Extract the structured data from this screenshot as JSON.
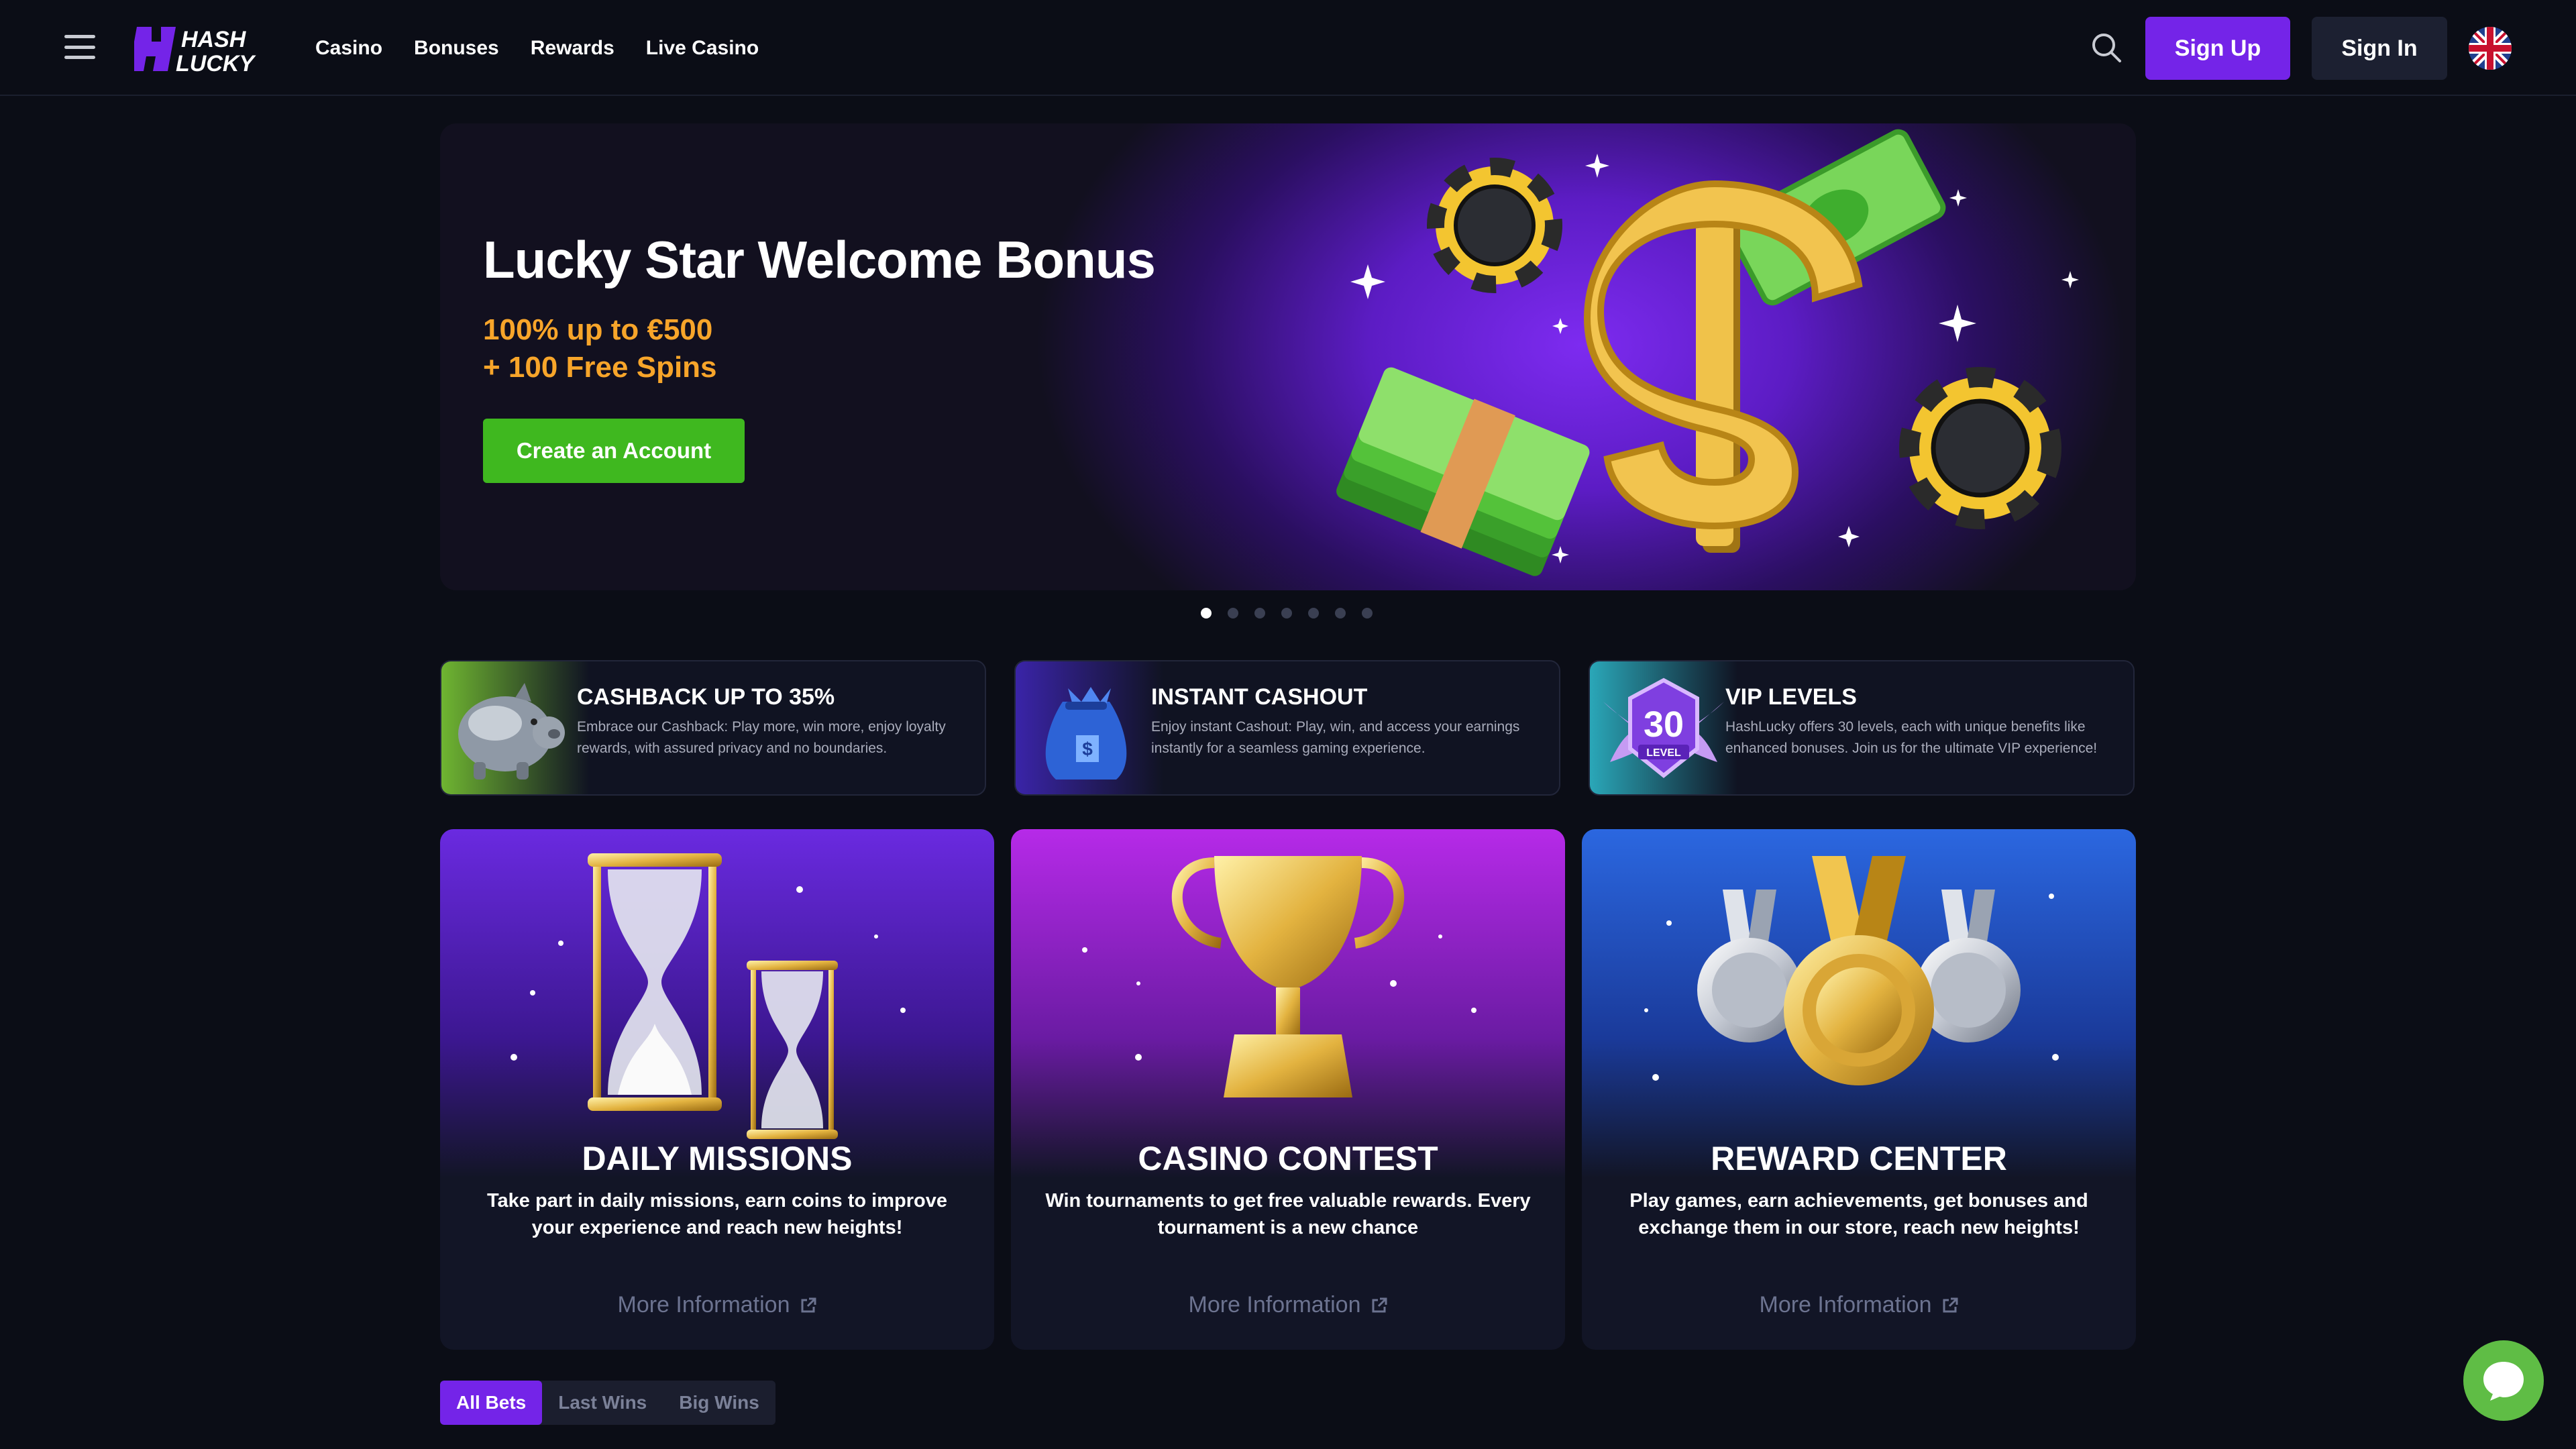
{
  "header": {
    "logo_line1": "HASH",
    "logo_line2": "LUCKY",
    "nav": [
      "Casino",
      "Bonuses",
      "Rewards",
      "Live Casino"
    ],
    "signup_label": "Sign Up",
    "signin_label": "Sign In",
    "language_icon": "uk-flag-icon"
  },
  "hero": {
    "title": "Lucky Star Welcome Bonus",
    "subtitle_line1": "100% up to €500",
    "subtitle_line2": "+ 100 Free Spins",
    "cta_label": "Create an Account",
    "carousel_total": 7,
    "carousel_active": 1
  },
  "promos": [
    {
      "title": "CASHBACK UP TO 35%",
      "description": "Embrace our Cashback: Play more, win more, enjoy loyalty rewards, with assured privacy and no boundaries.",
      "icon": "piggy-bank-icon"
    },
    {
      "title": "INSTANT CASHOUT",
      "description": "Enjoy instant Cashout: Play, win, and access your earnings instantly for a seamless gaming experience.",
      "icon": "money-bag-icon"
    },
    {
      "title": "VIP LEVELS",
      "description": "HashLucky offers 30 levels, each with unique benefits like enhanced bonuses. Join us for the ultimate VIP experience!",
      "icon": "vip-badge-icon",
      "badge_number": "30",
      "badge_label": "LEVEL"
    }
  ],
  "features": [
    {
      "title": "DAILY MISSIONS",
      "description": "Take part in daily missions, earn coins to improve your experience and reach new heights!",
      "link": "More Information",
      "icon": "hourglass-icon"
    },
    {
      "title": "CASINO CONTEST",
      "description": "Win tournaments to get free valuable rewards. Every tournament is a new chance",
      "link": "More Information",
      "icon": "trophy-icon"
    },
    {
      "title": "REWARD CENTER",
      "description": "Play games, earn achievements, get bonuses and exchange them in our store, reach new heights!",
      "link": "More Information",
      "icon": "medals-icon"
    }
  ],
  "bet_tabs": [
    "All Bets",
    "Last Wins",
    "Big Wins"
  ],
  "active_bet_tab": "All Bets",
  "colors": {
    "accent": "#7424e8",
    "cta_green": "#3fb81f",
    "gold_text": "#f7a52a",
    "chat_green": "#5fbd45"
  }
}
